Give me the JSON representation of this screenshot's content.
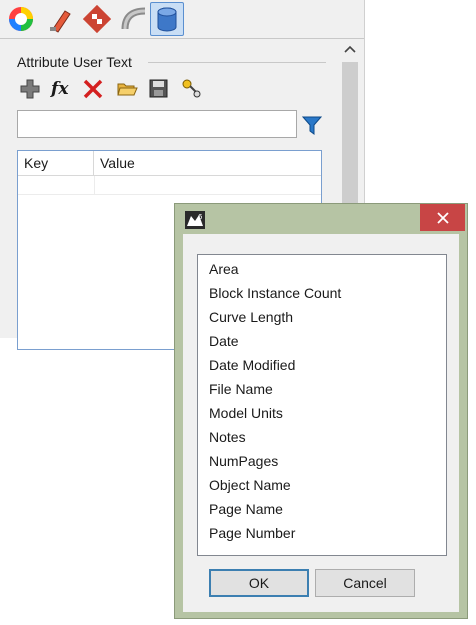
{
  "panel": {
    "tabs": [
      {
        "icon": "color-wheel-icon",
        "active": false
      },
      {
        "icon": "paint-tube-icon",
        "active": false
      },
      {
        "icon": "checker-material-icon",
        "active": false
      },
      {
        "icon": "curve-pipe-icon",
        "active": false
      },
      {
        "icon": "database-icon",
        "active": true
      }
    ],
    "section_title": "Attribute User Text",
    "toolbar": [
      "add-icon",
      "function-icon",
      "delete-icon",
      "open-folder-icon",
      "save-icon",
      "link-icon"
    ],
    "filter": {
      "value": "",
      "placeholder": ""
    },
    "table": {
      "columns": [
        "Key",
        "Value"
      ]
    }
  },
  "dialog": {
    "title": "",
    "items": [
      "Area",
      "Block Instance Count",
      "Curve Length",
      "Date",
      "Date Modified",
      "File Name",
      "Model Units",
      "Notes",
      "NumPages",
      "Object Name",
      "Page Name",
      "Page Number"
    ],
    "ok_label": "OK",
    "cancel_label": "Cancel"
  },
  "colors": {
    "close_button": "#c84545",
    "dialog_frame": "#b6c4a4",
    "active_tab": "#c9def5"
  }
}
